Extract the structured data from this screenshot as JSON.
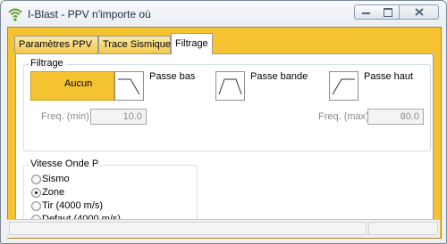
{
  "window": {
    "title": "I-Blast - PPV n'importe où"
  },
  "tabs": [
    {
      "label": "Paramètres PPV"
    },
    {
      "label": "Trace Sismique"
    },
    {
      "label": "Filtrage"
    }
  ],
  "filtrage_group": {
    "title": "Filtrage",
    "options": [
      {
        "label": "Aucun",
        "icon": "no-filter-icon",
        "selected": true
      },
      {
        "label": "Passe bas",
        "icon": "low-pass-filter-icon",
        "selected": false
      },
      {
        "label": "Passe bande",
        "icon": "band-pass-filter-icon",
        "selected": false
      },
      {
        "label": "Passe haut",
        "icon": "high-pass-filter-icon",
        "selected": false
      }
    ],
    "freq_min": {
      "label": "Freq. (min)",
      "value": "10.0"
    },
    "freq_max": {
      "label": "Freq. (max)",
      "value": "80.0"
    }
  },
  "vitesse_group": {
    "title": "Vitesse Onde P",
    "options": [
      {
        "label": "Sismo",
        "checked": false
      },
      {
        "label": "Zone",
        "checked": true
      },
      {
        "label": "Tir (4000 m/s)",
        "checked": false
      },
      {
        "label": "Defaut (4000 m/s)",
        "checked": false
      }
    ]
  },
  "colors": {
    "accent": "#f5c232",
    "panel_bg": "#ffffff",
    "disabled_text": "#8c8c8c"
  }
}
